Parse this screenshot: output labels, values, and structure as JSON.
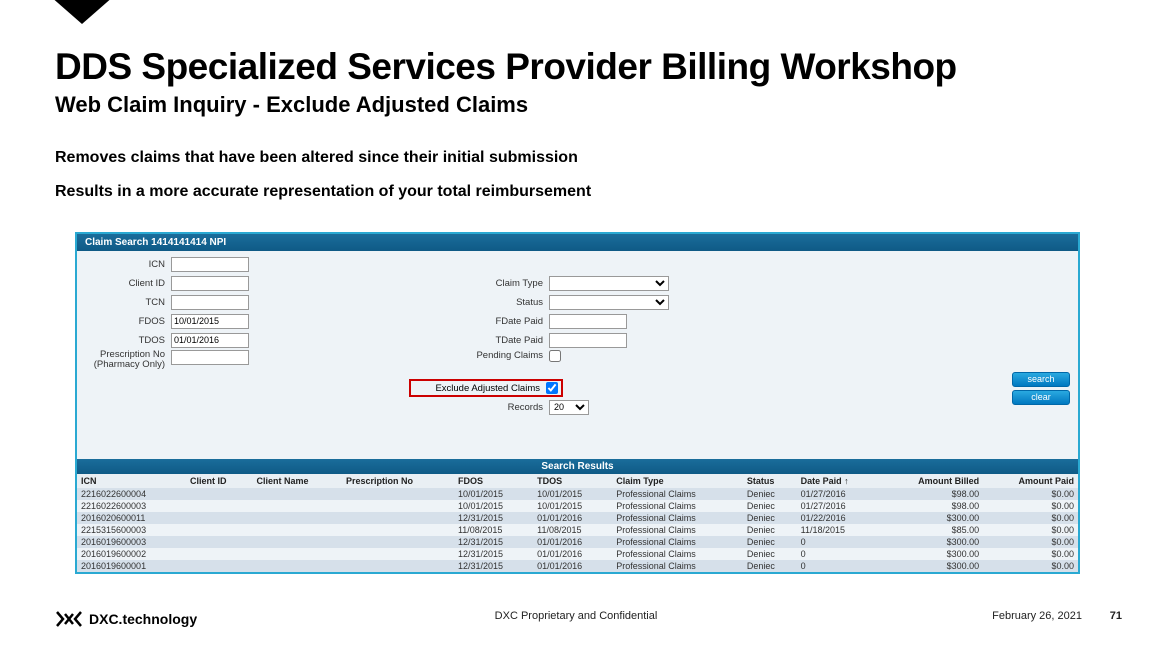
{
  "title": "DDS Specialized Services Provider Billing Workshop",
  "subtitle": "Web Claim Inquiry - Exclude Adjusted Claims",
  "bullet1": "Removes claims that have been altered since their initial submission",
  "bullet2": "Results in a more accurate representation of your total reimbursement",
  "panel_title": "Claim Search 1414141414 NPI",
  "labels": {
    "icn": "ICN",
    "client_id": "Client ID",
    "tcn": "TCN",
    "fdos": "FDOS",
    "tdos": "TDOS",
    "rx": "Prescription No (Pharmacy Only)",
    "claim_type": "Claim Type",
    "status": "Status",
    "fdate_paid": "FDate Paid",
    "tdate_paid": "TDate Paid",
    "pending": "Pending Claims",
    "exclude": "Exclude Adjusted Claims",
    "records": "Records"
  },
  "values": {
    "fdos": "10/01/2015",
    "tdos": "01/01/2016",
    "records": "20"
  },
  "buttons": {
    "search": "search",
    "clear": "clear"
  },
  "results_title": "Search Results",
  "columns": [
    "ICN",
    "Client ID",
    "Client Name",
    "Prescription No",
    "FDOS",
    "TDOS",
    "Claim Type",
    "Status",
    "Date Paid ↑",
    "Amount Billed",
    "Amount Paid"
  ],
  "rows": [
    {
      "icn": "2216022600004",
      "fdos": "10/01/2015",
      "tdos": "10/01/2015",
      "type": "Professional Claims",
      "status": "Deniec",
      "paid": "01/27/2016",
      "billed": "$98.00",
      "apaid": "$0.00"
    },
    {
      "icn": "2216022600003",
      "fdos": "10/01/2015",
      "tdos": "10/01/2015",
      "type": "Professional Claims",
      "status": "Deniec",
      "paid": "01/27/2016",
      "billed": "$98.00",
      "apaid": "$0.00"
    },
    {
      "icn": "2016020600011",
      "fdos": "12/31/2015",
      "tdos": "01/01/2016",
      "type": "Professional Claims",
      "status": "Deniec",
      "paid": "01/22/2016",
      "billed": "$300.00",
      "apaid": "$0.00"
    },
    {
      "icn": "2215315600003",
      "fdos": "11/08/2015",
      "tdos": "11/08/2015",
      "type": "Professional Claims",
      "status": "Deniec",
      "paid": "11/18/2015",
      "billed": "$85.00",
      "apaid": "$0.00"
    },
    {
      "icn": "2016019600003",
      "fdos": "12/31/2015",
      "tdos": "01/01/2016",
      "type": "Professional Claims",
      "status": "Deniec",
      "paid": "0",
      "billed": "$300.00",
      "apaid": "$0.00"
    },
    {
      "icn": "2016019600002",
      "fdos": "12/31/2015",
      "tdos": "01/01/2016",
      "type": "Professional Claims",
      "status": "Deniec",
      "paid": "0",
      "billed": "$300.00",
      "apaid": "$0.00"
    },
    {
      "icn": "2016019600001",
      "fdos": "12/31/2015",
      "tdos": "01/01/2016",
      "type": "Professional Claims",
      "status": "Deniec",
      "paid": "0",
      "billed": "$300.00",
      "apaid": "$0.00"
    }
  ],
  "footer": {
    "logo_text": "DXC.technology",
    "center": "DXC Proprietary and Confidential",
    "date": "February 26, 2021",
    "page": "71"
  }
}
